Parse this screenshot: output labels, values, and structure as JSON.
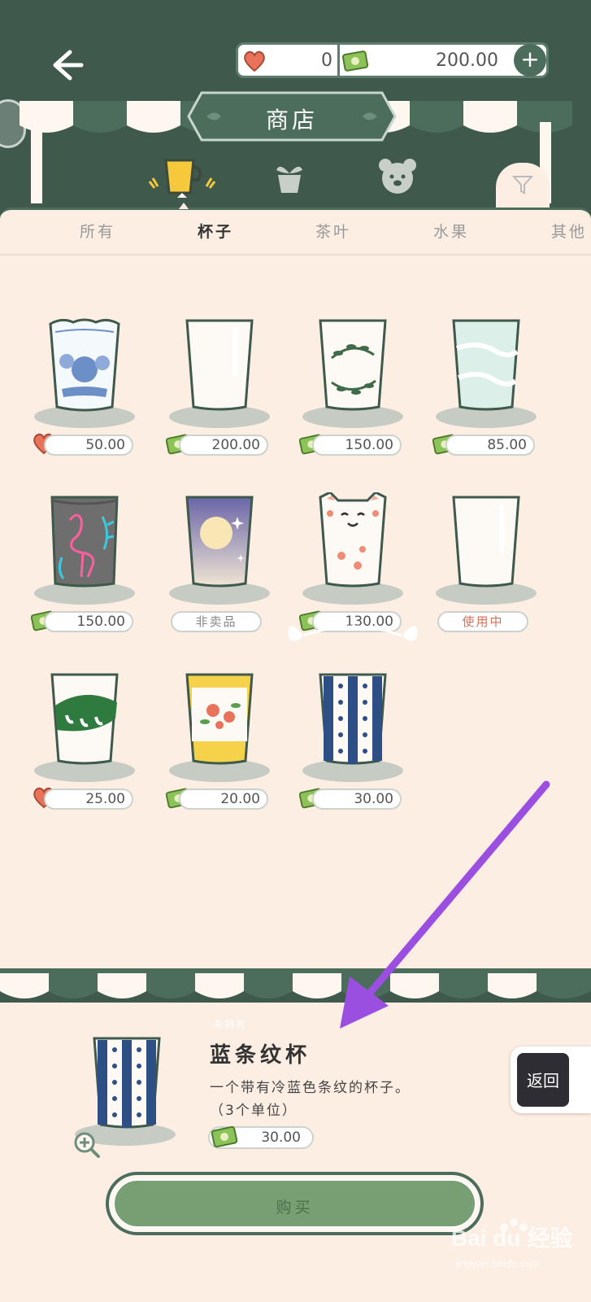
{
  "header": {
    "hearts_value": "0",
    "money_value": "200.00",
    "add_label": "+",
    "title": "商店"
  },
  "tabs": [
    {
      "label": "所有",
      "active": false
    },
    {
      "label": "杯子",
      "active": true
    },
    {
      "label": "茶叶",
      "active": false
    },
    {
      "label": "水果",
      "active": false
    },
    {
      "label": "其他",
      "active": false
    }
  ],
  "category_icons": [
    "cup-icon",
    "plant-icon",
    "bear-icon"
  ],
  "items": [
    {
      "name": "blue-flower-cup",
      "currency": "heart",
      "price": "50.00"
    },
    {
      "name": "plain-cup",
      "currency": "money",
      "price": "200.00"
    },
    {
      "name": "leaf-wreath-cup",
      "currency": "money",
      "price": "150.00"
    },
    {
      "name": "wave-cup",
      "currency": "money",
      "price": "85.00"
    },
    {
      "name": "flamingo-cup",
      "currency": "money",
      "price": "150.00"
    },
    {
      "name": "moon-cup",
      "status": "非卖品"
    },
    {
      "name": "cat-cup",
      "currency": "money",
      "price": "130.00"
    },
    {
      "name": "default-cup",
      "status": "使用中"
    },
    {
      "name": "lily-cup",
      "currency": "heart",
      "price": "25.00"
    },
    {
      "name": "yellow-flower-cup",
      "currency": "money",
      "price": "20.00"
    },
    {
      "name": "blue-stripe-cup",
      "currency": "money",
      "price": "30.00"
    }
  ],
  "detail": {
    "tag": "未拥有",
    "name": "蓝条纹杯",
    "description": "一个带有冷蓝色条纹的杯子。",
    "units": "（3个单位）",
    "price": "30.00"
  },
  "buy_label": "购买",
  "return_label": "返回",
  "watermark": {
    "brand": "Bai du 经验",
    "url": "jingyan.baidu.com"
  },
  "colors": {
    "dark_green": "#3f5a4c",
    "panel": "#fdeee4",
    "accent": "#4c6d5c",
    "button": "#789f74",
    "arrow": "#9b4fe0"
  }
}
